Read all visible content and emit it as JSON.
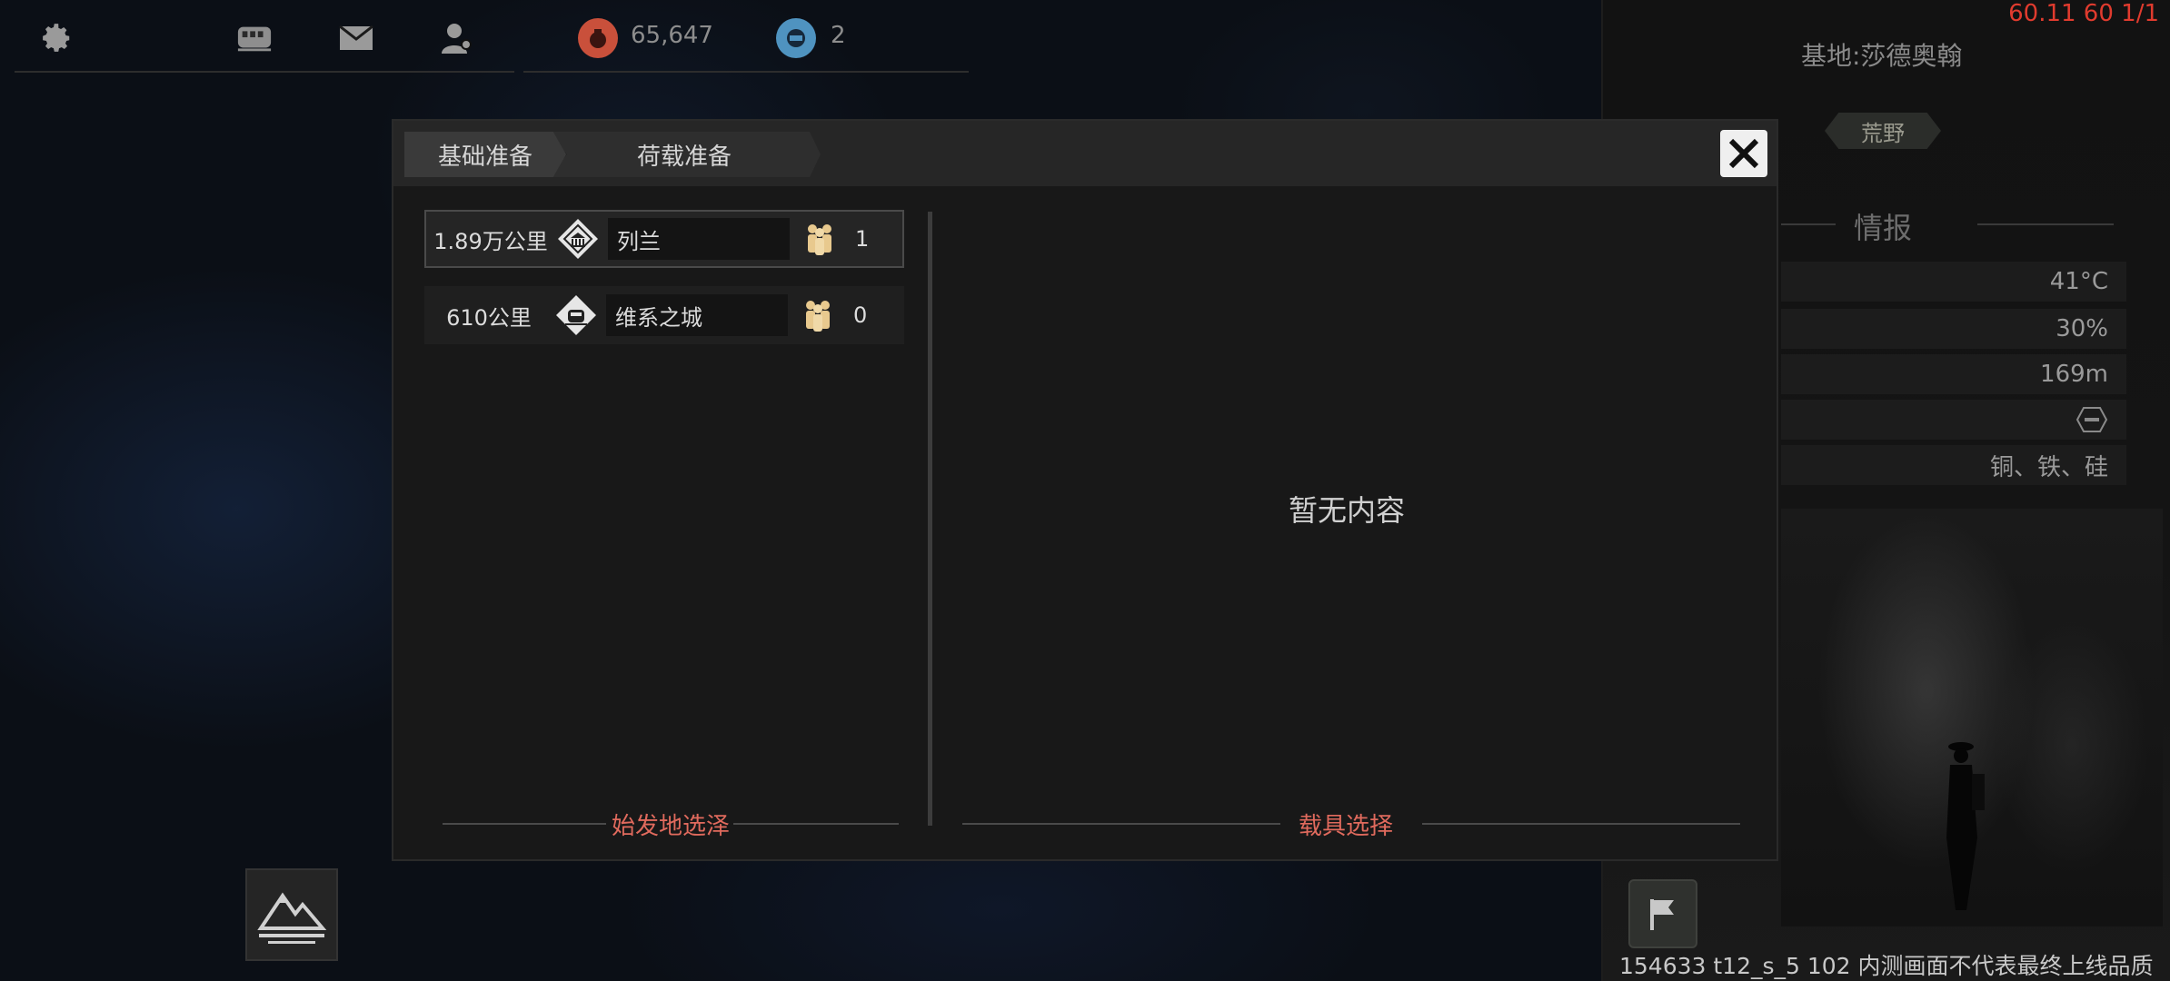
{
  "topbar": {
    "icons": [
      "gear-icon",
      "train-icon",
      "mail-icon",
      "profile-icon"
    ],
    "resources": [
      {
        "icon": "fuel-icon",
        "value": "65,647",
        "color": "#c9503b"
      },
      {
        "icon": "ticket-icon",
        "value": "2",
        "color": "#4f93c0"
      }
    ]
  },
  "debug": {
    "fps": "60.11 60 1/1"
  },
  "base": {
    "title": "基地:莎德奥翰",
    "terrain_tag": "荒野",
    "intel_header": "情报",
    "info": [
      "41°C",
      "30%",
      "169m",
      "铜、铁、硅"
    ]
  },
  "dialog": {
    "tabs": [
      "基础准备",
      "荷载准备"
    ],
    "destinations": [
      {
        "distance": "1.89万公里",
        "name": "列兰",
        "count": "1"
      },
      {
        "distance": "610公里",
        "name": "维系之城",
        "count": "0"
      }
    ],
    "origin_label": "始发地选泽",
    "vehicle_label": "载具选择",
    "empty_text": "暂无内容"
  },
  "footer": {
    "note": "154633 t12_s_5 102  内测画面不代表最终上线品质"
  },
  "colors": {
    "accent": "#e06a5d",
    "panel": "#181818",
    "fps": "#e03b2e"
  }
}
